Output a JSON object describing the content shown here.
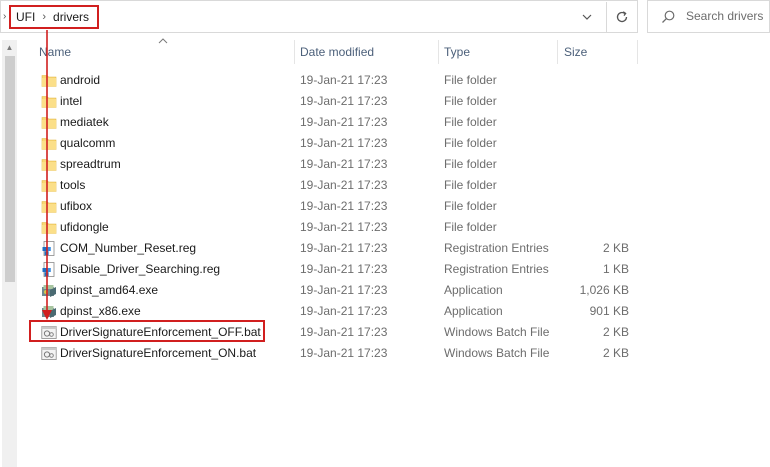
{
  "address_bar": {
    "left_mark": "›",
    "breadcrumbs": [
      "UFI",
      "drivers"
    ],
    "separator": "›",
    "dropdown_icon": "chevron-down-icon",
    "refresh_icon": "refresh-icon"
  },
  "search": {
    "placeholder": "Search drivers",
    "icon": "search-icon"
  },
  "columns": {
    "name": "Name",
    "date": "Date modified",
    "type": "Type",
    "size": "Size",
    "sort": "ascending"
  },
  "files": [
    {
      "name": "android",
      "date": "19-Jan-21 17:23",
      "type": "File folder",
      "size": "",
      "icon": "folder-icon"
    },
    {
      "name": "intel",
      "date": "19-Jan-21 17:23",
      "type": "File folder",
      "size": "",
      "icon": "folder-icon"
    },
    {
      "name": "mediatek",
      "date": "19-Jan-21 17:23",
      "type": "File folder",
      "size": "",
      "icon": "folder-icon"
    },
    {
      "name": "qualcomm",
      "date": "19-Jan-21 17:23",
      "type": "File folder",
      "size": "",
      "icon": "folder-icon"
    },
    {
      "name": "spreadtrum",
      "date": "19-Jan-21 17:23",
      "type": "File folder",
      "size": "",
      "icon": "folder-icon"
    },
    {
      "name": "tools",
      "date": "19-Jan-21 17:23",
      "type": "File folder",
      "size": "",
      "icon": "folder-icon"
    },
    {
      "name": "ufibox",
      "date": "19-Jan-21 17:23",
      "type": "File folder",
      "size": "",
      "icon": "folder-icon"
    },
    {
      "name": "ufidongle",
      "date": "19-Jan-21 17:23",
      "type": "File folder",
      "size": "",
      "icon": "folder-icon"
    },
    {
      "name": "COM_Number_Reset.reg",
      "date": "19-Jan-21 17:23",
      "type": "Registration Entries",
      "size": "2 KB",
      "icon": "registry-file-icon"
    },
    {
      "name": "Disable_Driver_Searching.reg",
      "date": "19-Jan-21 17:23",
      "type": "Registration Entries",
      "size": "1 KB",
      "icon": "registry-file-icon"
    },
    {
      "name": "dpinst_amd64.exe",
      "date": "19-Jan-21 17:23",
      "type": "Application",
      "size": "1,026 KB",
      "icon": "installer-app-icon"
    },
    {
      "name": "dpinst_x86.exe",
      "date": "19-Jan-21 17:23",
      "type": "Application",
      "size": "901 KB",
      "icon": "installer-app-icon"
    },
    {
      "name": "DriverSignatureEnforcement_OFF.bat",
      "date": "19-Jan-21 17:23",
      "type": "Windows Batch File",
      "size": "2 KB",
      "icon": "batch-file-icon"
    },
    {
      "name": "DriverSignatureEnforcement_ON.bat",
      "date": "19-Jan-21 17:23",
      "type": "Windows Batch File",
      "size": "2 KB",
      "icon": "batch-file-icon"
    }
  ],
  "colors": {
    "annotation_red": "#d11f1f",
    "folder_yellow": "#f8d775",
    "header_text": "#4c607a"
  }
}
